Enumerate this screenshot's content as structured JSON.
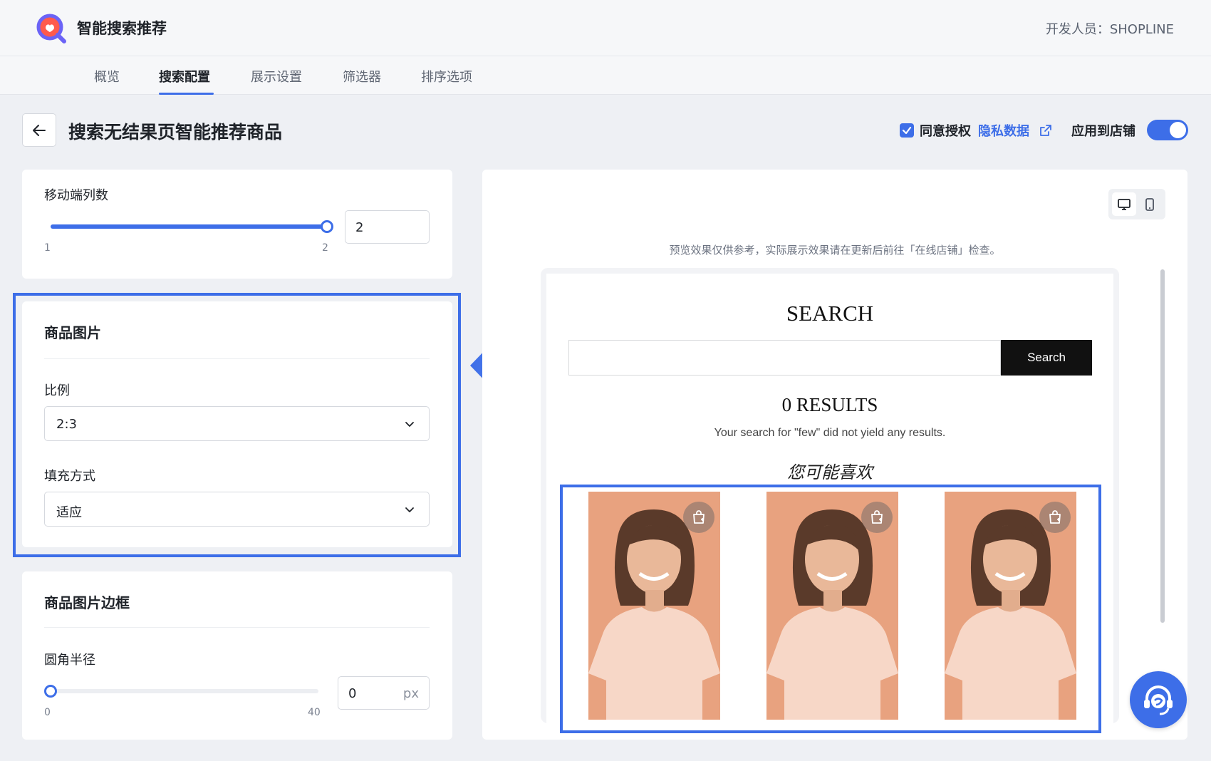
{
  "header": {
    "app_name": "智能搜索推荐",
    "developer": "开发人员：SHOPLINE",
    "logo_icon": "search-heart-logo"
  },
  "tabs": [
    {
      "label": "概览",
      "active": false
    },
    {
      "label": "搜索配置",
      "active": true
    },
    {
      "label": "展示设置",
      "active": false
    },
    {
      "label": "筛选器",
      "active": false
    },
    {
      "label": "排序选项",
      "active": false
    }
  ],
  "page": {
    "title": "搜索无结果页智能推荐商品",
    "consent_label": "同意授权",
    "privacy_link": "隐私数据",
    "consent_checked": true,
    "apply_label": "应用到店铺",
    "apply_enabled": true
  },
  "mobile_columns": {
    "label": "移动端列数",
    "min_label": "1",
    "max_label": "2",
    "value": "2",
    "level": 1.0
  },
  "product_image": {
    "title": "商品图片",
    "ratio_label": "比例",
    "ratio_value": "2:3",
    "fill_label": "填充方式",
    "fill_value": "适应"
  },
  "image_border": {
    "title": "商品图片边框",
    "radius_label": "圆角半径",
    "min_label": "0",
    "max_label": "40",
    "value": "0",
    "unit": "px",
    "level": 0.0
  },
  "preview": {
    "note": "预览效果仅供参考，实际展示效果请在更新后前往「在线店铺」检查。",
    "search_title": "SEARCH",
    "search_button": "Search",
    "results_title": "0 RESULTS",
    "results_message": "Your search for \"few\" did not yield any results.",
    "recommend_title": "您可能喜欢",
    "products": [
      {
        "name": "product-1"
      },
      {
        "name": "product-2"
      },
      {
        "name": "product-3"
      }
    ],
    "device_modes": [
      "desktop",
      "mobile"
    ],
    "active_device": "desktop"
  },
  "colors": {
    "accent": "#3d6ee8",
    "product_bg": "#e8a27f",
    "shirt": "#f7d7c7"
  }
}
